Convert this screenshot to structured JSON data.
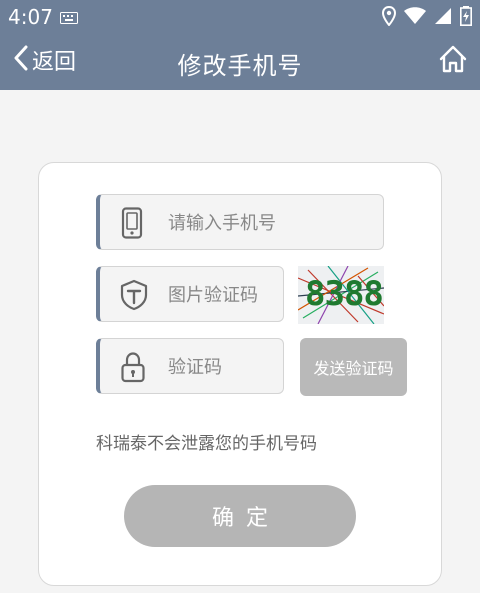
{
  "status_bar": {
    "time": "4:07"
  },
  "nav": {
    "back_label": "返回",
    "title": "修改手机号"
  },
  "form": {
    "phone_placeholder": "请输入手机号",
    "captcha_placeholder": "图片验证码",
    "captcha_value": "8388",
    "code_placeholder": "验证码",
    "send_code_label": "发送验证码",
    "privacy_notice": "科瑞泰不会泄露您的手机号码",
    "confirm_label": "确定"
  },
  "colors": {
    "header": "#6d7f98",
    "accent": "#6d7f98",
    "disabled_button": "#b9b9b9"
  },
  "icons": [
    "keyboard-icon",
    "location-icon",
    "wifi-icon",
    "signal-icon",
    "battery-icon",
    "back-chevron-icon",
    "home-icon",
    "phone-icon",
    "shield-icon",
    "lock-icon"
  ]
}
